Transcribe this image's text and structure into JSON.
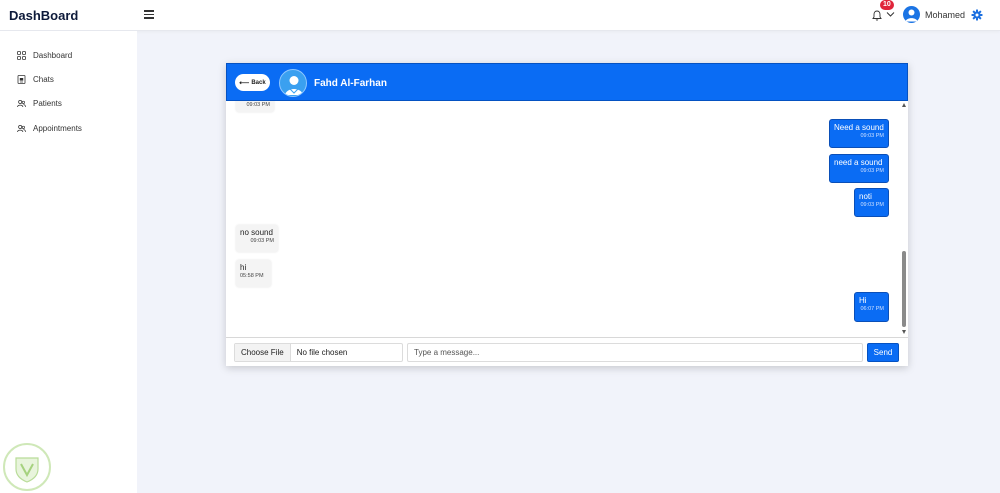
{
  "app": {
    "brand": "DashBoard"
  },
  "topbar": {
    "notification_count": "10",
    "username": "Mohamed"
  },
  "sidebar": {
    "items": [
      {
        "label": "Dashboard",
        "icon": "grid-icon"
      },
      {
        "label": "Chats",
        "icon": "chat-icon"
      },
      {
        "label": "Patients",
        "icon": "users-icon"
      },
      {
        "label": "Appointments",
        "icon": "users-icon"
      }
    ]
  },
  "chat": {
    "back_label": "Back",
    "contact_name": "Fahd Al-Farhan",
    "messages": [
      {
        "direction": "in",
        "text": "",
        "time": "09:03 PM"
      },
      {
        "direction": "out",
        "text": "Need a sound",
        "time": "09:03 PM"
      },
      {
        "direction": "out",
        "text": "need a sound",
        "time": "09:03 PM"
      },
      {
        "direction": "out",
        "text": "noti",
        "time": "09:03 PM"
      },
      {
        "direction": "in",
        "text": "no sound",
        "time": "09:03 PM"
      },
      {
        "direction": "in",
        "text": "hi",
        "time": "05:58 PM"
      },
      {
        "direction": "out",
        "text": "Hi",
        "time": "06:07 PM"
      }
    ]
  },
  "composer": {
    "file_button": "Choose File",
    "file_status": "No file chosen",
    "message_placeholder": "Type a message...",
    "send_label": "Send"
  },
  "colors": {
    "accent": "#0a6cf4",
    "badge": "#e0243a",
    "page_background": "#f1f3fa"
  }
}
